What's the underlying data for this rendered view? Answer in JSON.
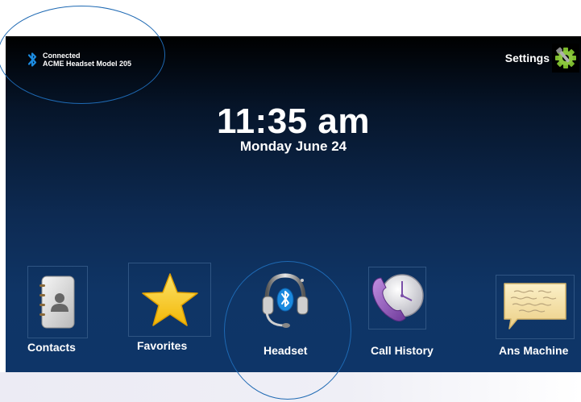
{
  "status": {
    "line1": "Connected",
    "line2": "ACME Headset Model 205",
    "icon": "bluetooth-icon"
  },
  "settings": {
    "label": "Settings",
    "icon": "gear-icon"
  },
  "clock": {
    "time": "11:35 am",
    "date": "Monday June 24"
  },
  "apps": [
    {
      "label": "Contacts",
      "icon": "contacts-icon"
    },
    {
      "label": "Favorites",
      "icon": "star-icon"
    },
    {
      "label": "Headset",
      "icon": "headset-icon"
    },
    {
      "label": "Call History",
      "icon": "call-history-icon"
    },
    {
      "label": "Ans Machine",
      "icon": "message-icon"
    }
  ],
  "colors": {
    "screen_bg_top": "#000000",
    "screen_bg_bottom": "#0e3568",
    "bluetooth_blue": "#1c8be0",
    "annotation": "#1e69b3",
    "star_yellow": "#f7c61a",
    "call_purple": "#8a5bb5",
    "message_paper": "#f3e2a6"
  }
}
